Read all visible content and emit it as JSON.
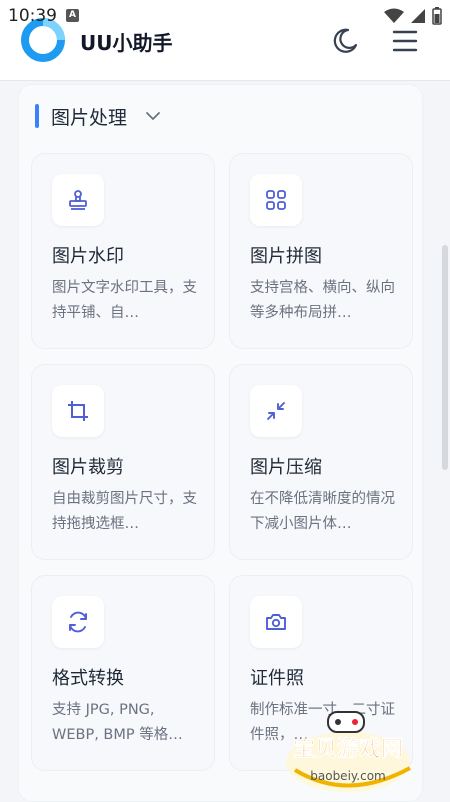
{
  "status": {
    "time": "10:39",
    "notif_letter": "A"
  },
  "header": {
    "title": "UU小助手"
  },
  "section": {
    "title": "图片处理"
  },
  "cards": [
    {
      "title": "图片水印",
      "desc": "图片文字水印工具，支持平铺、自…",
      "icon": "stamp-icon"
    },
    {
      "title": "图片拼图",
      "desc": "支持宫格、横向、纵向等多种布局拼…",
      "icon": "grid-icon"
    },
    {
      "title": "图片裁剪",
      "desc": "自由裁剪图片尺寸，支持拖拽选框…",
      "icon": "crop-icon"
    },
    {
      "title": "图片压缩",
      "desc": "在不降低清晰度的情况下减小图片体…",
      "icon": "compress-icon"
    },
    {
      "title": "格式转换",
      "desc": "支持 JPG, PNG, WEBP, BMP 等格…",
      "icon": "refresh-icon"
    },
    {
      "title": "证件照",
      "desc": "制作标准一寸、二寸证件照，…",
      "icon": "camera-icon"
    }
  ],
  "watermark": {
    "cn": "宝贝游戏网",
    "url": "baobeiy.com"
  },
  "colors": {
    "accent": "#3b82f6",
    "icon": "#4f5fd6",
    "logo": "#1e9bf0"
  }
}
